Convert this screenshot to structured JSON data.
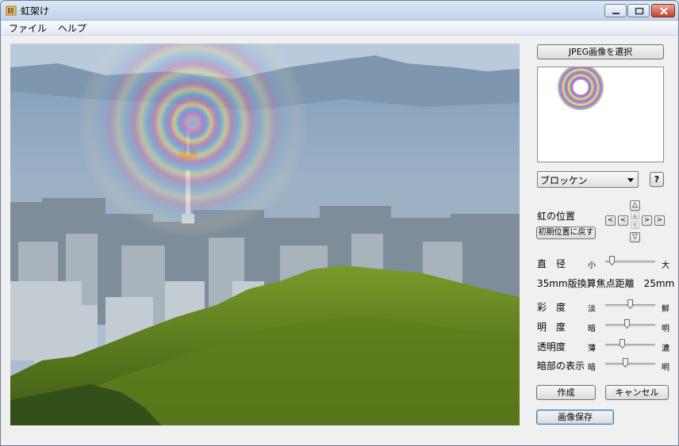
{
  "window": {
    "title": "虹架け"
  },
  "menu": {
    "items": [
      "ファイル",
      "ヘルプ"
    ]
  },
  "panel": {
    "select_image_button": "JPEG画像を選択",
    "mode_value": "ブロッケン",
    "help_button": "?",
    "position_label": "虹の位置",
    "reset_position_button": "初期位置に戻す",
    "arrows": {
      "up": "△",
      "down": "▽",
      "left_fast": "<",
      "left": "<",
      "right": ">",
      "right_fast": ">"
    },
    "diameter": {
      "label": "直　径",
      "min": "小",
      "max": "大",
      "value": 0.15
    },
    "focal_length": "35mm版換算焦点距離　25mm",
    "saturation": {
      "label": "彩　度",
      "min": "淡",
      "max": "鮮",
      "value": 0.5
    },
    "brightness": {
      "label": "明　度",
      "min": "暗",
      "max": "明",
      "value": 0.45
    },
    "transparency": {
      "label": "透明度",
      "min": "薄",
      "max": "濃",
      "value": 0.35
    },
    "dark_display": {
      "label": "暗部の表示",
      "min": "暗",
      "max": "明",
      "value": 0.42
    },
    "create_button": "作成",
    "cancel_button": "キャンセル",
    "save_button": "画像保存"
  },
  "colors": {
    "accent": "#3c7fb1"
  }
}
